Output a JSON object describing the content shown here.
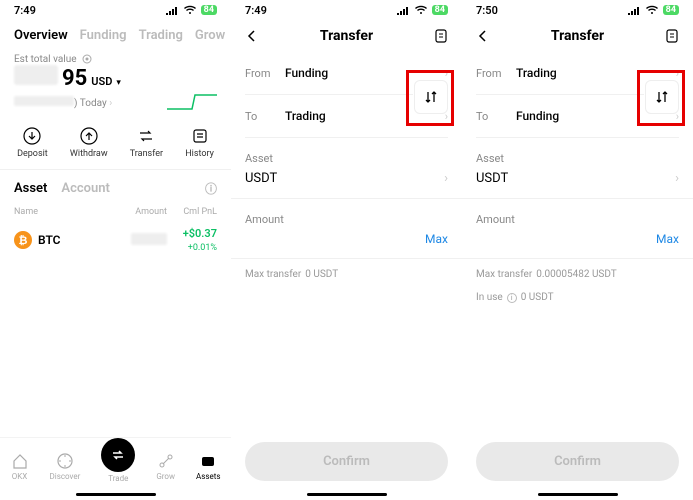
{
  "status": {
    "time1": "7:49",
    "time2": "7:49",
    "time3": "7:50",
    "battery": "84"
  },
  "screen1": {
    "tabs": [
      "Overview",
      "Funding",
      "Trading",
      "Grow"
    ],
    "est_label": "Est total value",
    "value_suffix": "95",
    "unit": "USD",
    "today_label": ") Today",
    "actions": [
      {
        "label": "Deposit"
      },
      {
        "label": "Withdraw"
      },
      {
        "label": "Transfer"
      },
      {
        "label": "History"
      }
    ],
    "asset_tabs": [
      "Asset",
      "Account"
    ],
    "list_headers": [
      "Name",
      "Amount",
      "Cml PnL"
    ],
    "rows": [
      {
        "name": "BTC",
        "pnl": "+$0.37",
        "pnl_pct": "+0.01%"
      }
    ],
    "nav": [
      "OKX",
      "Discover",
      "Trade",
      "Grow",
      "Assets"
    ]
  },
  "screen2": {
    "title": "Transfer",
    "from_label": "From",
    "from_value": "Funding",
    "to_label": "To",
    "to_value": "Trading",
    "asset_label": "Asset",
    "asset_value": "USDT",
    "amount_label": "Amount",
    "max_label": "Max",
    "max_transfer_label": "Max transfer",
    "max_transfer_value": "0 USDT",
    "confirm": "Confirm"
  },
  "screen3": {
    "title": "Transfer",
    "from_label": "From",
    "from_value": "Trading",
    "to_label": "To",
    "to_value": "Funding",
    "asset_label": "Asset",
    "asset_value": "USDT",
    "amount_label": "Amount",
    "max_label": "Max",
    "max_transfer_label": "Max transfer",
    "max_transfer_value": "0.00005482 USDT",
    "inuse_label": "In use",
    "inuse_value": "0 USDT",
    "confirm": "Confirm"
  }
}
